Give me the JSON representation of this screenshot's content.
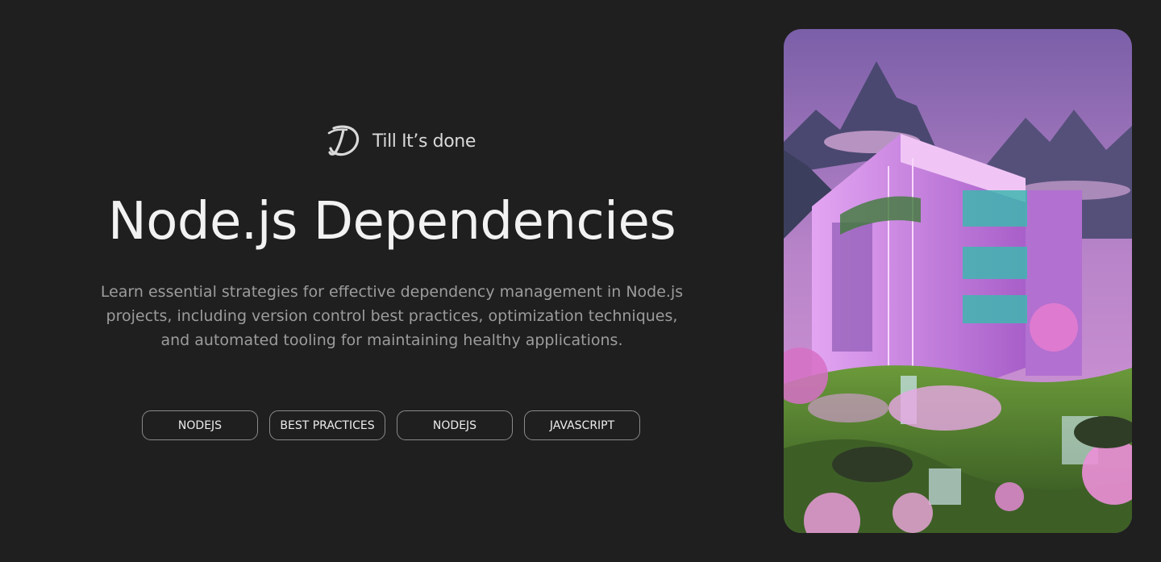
{
  "brand": {
    "name": "Till It’s done",
    "logo_icon": "script-d-logo-icon"
  },
  "hero": {
    "title": "Node.js Dependencies",
    "description": "Learn essential strategies for effective dependency management in Node.js projects, including version control best practices, optimization techniques, and automated tooling for maintaining healthy applications.",
    "tags": [
      "NODEJS",
      "BEST PRACTICES",
      "NODEJS",
      "JAVASCRIPT"
    ]
  },
  "image": {
    "subject": "futuristic-purple-building-landscape",
    "colors": {
      "sky_top": "#7a5fa8",
      "sky_bottom": "#d79ad8",
      "building": "#c77ee0",
      "glass": "#3fb6b0",
      "grass": "#4f7d2e",
      "blossom": "#e27bcf"
    }
  },
  "theme": {
    "background": "#1f1f1f",
    "text_primary": "#f2f2f2",
    "text_muted": "#9c9c9c",
    "tag_border": "#8a8a8a"
  }
}
